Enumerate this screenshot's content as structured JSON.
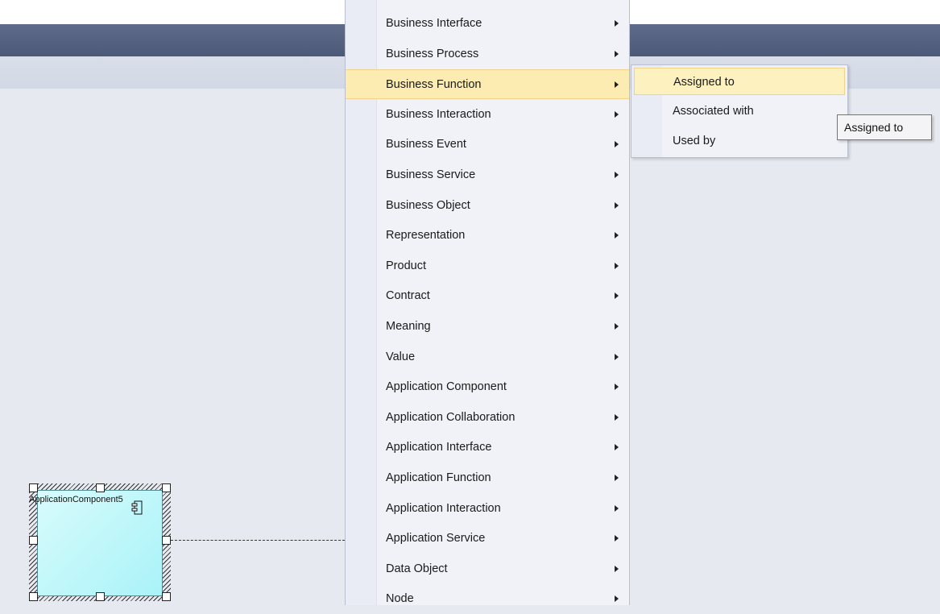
{
  "diagram": {
    "element_label": "ApplicationComponent5"
  },
  "menu": {
    "items": [
      {
        "label": "Business Interface"
      },
      {
        "label": "Business Process"
      },
      {
        "label": "Business Function",
        "active": true
      },
      {
        "label": "Business Interaction"
      },
      {
        "label": "Business Event"
      },
      {
        "label": "Business Service"
      },
      {
        "label": "Business Object"
      },
      {
        "label": "Representation"
      },
      {
        "label": "Product"
      },
      {
        "label": "Contract"
      },
      {
        "label": "Meaning"
      },
      {
        "label": "Value"
      },
      {
        "label": "Application Component"
      },
      {
        "label": "Application Collaboration"
      },
      {
        "label": "Application Interface"
      },
      {
        "label": "Application Function"
      },
      {
        "label": "Application Interaction"
      },
      {
        "label": "Application Service"
      },
      {
        "label": "Data Object"
      },
      {
        "label": "Node"
      }
    ]
  },
  "submenu": {
    "items": [
      {
        "label": "Assigned to",
        "active": true
      },
      {
        "label": "Associated with"
      },
      {
        "label": "Used by"
      }
    ]
  },
  "tooltip": {
    "text": "Assigned to"
  }
}
